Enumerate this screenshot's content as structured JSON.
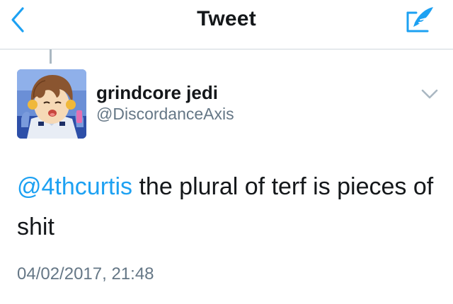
{
  "navbar": {
    "title": "Tweet",
    "back_icon": "chevron-left-icon",
    "compose_icon": "compose-feather-icon"
  },
  "tweet": {
    "author_name": "grindcore jedi",
    "author_handle": "@DiscordanceAxis",
    "avatar_icon": "anime-character-avatar",
    "mention": "@4thcurtis",
    "text_after_mention": " the plural of terf is pieces of shit",
    "timestamp": "04/02/2017, 21:48",
    "menu_icon": "chevron-down-icon"
  },
  "colors": {
    "accent": "#1da1f2",
    "text_primary": "#14171a",
    "text_secondary": "#657786",
    "divider": "#cfd6dc"
  }
}
